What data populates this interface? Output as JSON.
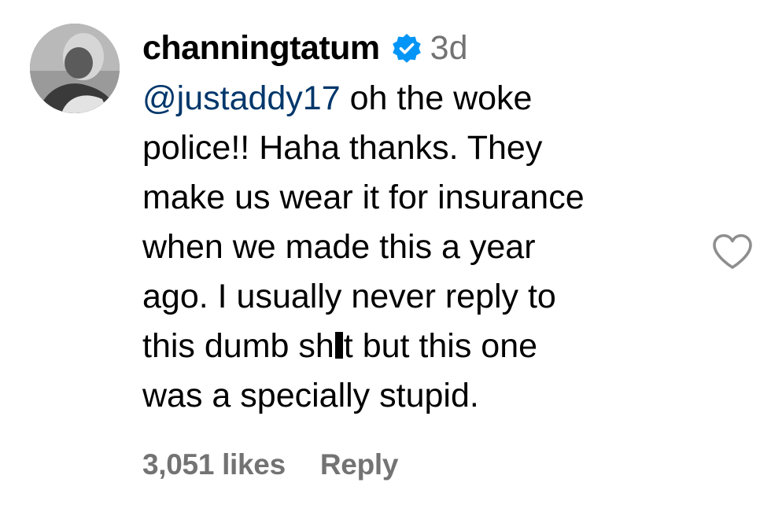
{
  "comment": {
    "username": "channingtatum",
    "verified": true,
    "timestamp": "3d",
    "mention": "@justaddy17",
    "lines": [
      " oh the woke",
      "police!! Haha thanks. They",
      "make us wear it for insurance",
      "when we made this a year",
      "ago. I usually never reply to",
      "this dumb sh",
      "t but this one",
      "was a specially stupid."
    ],
    "likes": "3,051 likes",
    "reply_label": "Reply"
  },
  "icons": {
    "avatar": "avatar",
    "verified": "verified-badge-icon",
    "like": "heart-icon"
  },
  "colors": {
    "mention": "#00376b",
    "muted": "#737373",
    "verified": "#0095f6",
    "heart": "#8e8e8e"
  }
}
